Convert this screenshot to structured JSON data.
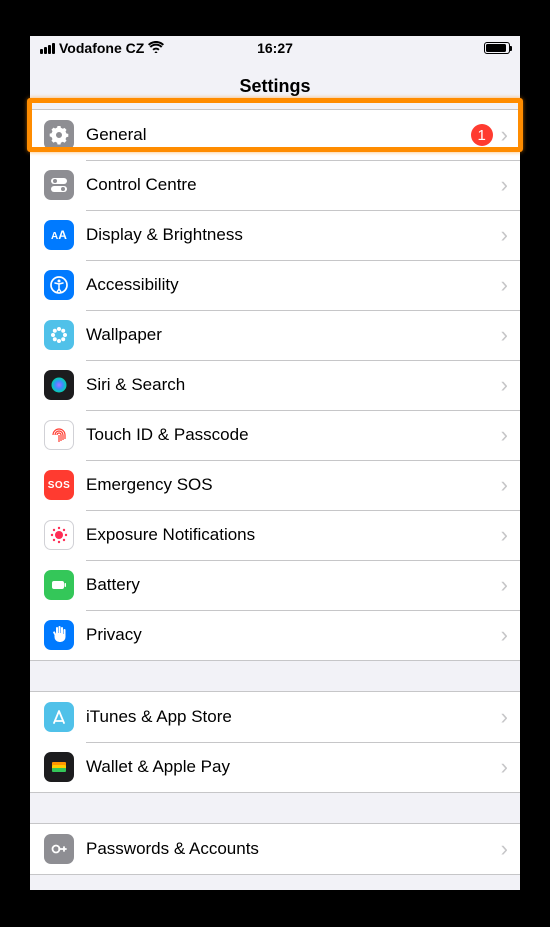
{
  "status_bar": {
    "carrier": "Vodafone CZ",
    "time": "16:27"
  },
  "nav": {
    "title": "Settings"
  },
  "sections": [
    {
      "rows": [
        {
          "id": "general",
          "label": "General",
          "badge": "1",
          "icon": "gear-icon"
        },
        {
          "id": "control",
          "label": "Control Centre",
          "icon": "toggles-icon"
        },
        {
          "id": "display",
          "label": "Display & Brightness",
          "icon": "aa-icon"
        },
        {
          "id": "accessibility",
          "label": "Accessibility",
          "icon": "person-circle-icon"
        },
        {
          "id": "wallpaper",
          "label": "Wallpaper",
          "icon": "flower-icon"
        },
        {
          "id": "siri",
          "label": "Siri & Search",
          "icon": "siri-icon"
        },
        {
          "id": "touchid",
          "label": "Touch ID & Passcode",
          "icon": "fingerprint-icon"
        },
        {
          "id": "sos",
          "label": "Emergency SOS",
          "icon": "sos-icon",
          "icon_text": "SOS"
        },
        {
          "id": "exposure",
          "label": "Exposure Notifications",
          "icon": "virus-icon"
        },
        {
          "id": "battery",
          "label": "Battery",
          "icon": "battery-icon"
        },
        {
          "id": "privacy",
          "label": "Privacy",
          "icon": "hand-icon"
        }
      ]
    },
    {
      "rows": [
        {
          "id": "itunes",
          "label": "iTunes & App Store",
          "icon": "appstore-icon"
        },
        {
          "id": "wallet",
          "label": "Wallet & Apple Pay",
          "icon": "wallet-icon"
        }
      ]
    },
    {
      "rows": [
        {
          "id": "passwords",
          "label": "Passwords & Accounts",
          "icon": "key-icon"
        }
      ]
    }
  ],
  "highlight_row_id": "general"
}
